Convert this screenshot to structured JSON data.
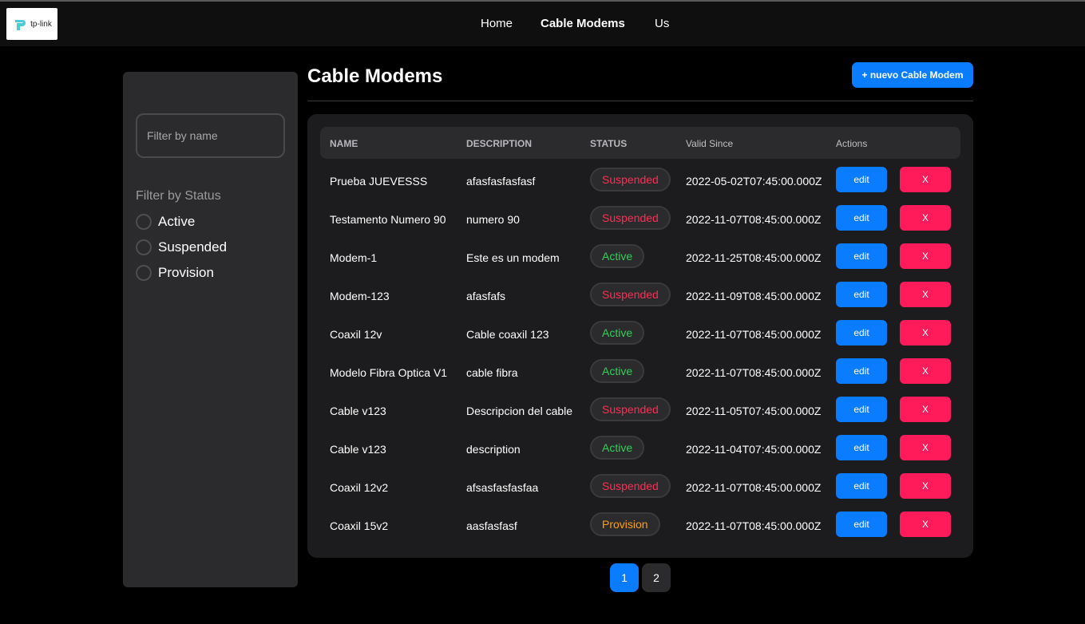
{
  "brand": {
    "logo_text": "tp-link"
  },
  "nav": {
    "items": [
      {
        "label": "Home",
        "active": false
      },
      {
        "label": "Cable Modems",
        "active": true
      },
      {
        "label": "Us",
        "active": false
      }
    ]
  },
  "sidebar": {
    "search_placeholder": "Filter by name",
    "search_value": "",
    "filter_title": "Filter by Status",
    "status_options": [
      {
        "label": "Active",
        "checked": false
      },
      {
        "label": "Suspended",
        "checked": false
      },
      {
        "label": "Provision",
        "checked": false
      }
    ]
  },
  "main": {
    "title": "Cable Modems",
    "new_button_label": "+ nuevo Cable Modem"
  },
  "table": {
    "headers": [
      "NAME",
      "DESCRIPTION",
      "STATUS",
      "Valid Since",
      "Actions"
    ],
    "edit_label": "edit",
    "delete_label": "X",
    "rows": [
      {
        "name": "Prueba JUEVESSS",
        "description": "afasfasfasfasf",
        "status": "Suspended",
        "valid_since": "2022-05-02T07:45:00.000Z"
      },
      {
        "name": "Testamento Numero 90",
        "description": "numero 90",
        "status": "Suspended",
        "valid_since": "2022-11-07T08:45:00.000Z"
      },
      {
        "name": "Modem-1",
        "description": "Este es un modem",
        "status": "Active",
        "valid_since": "2022-11-25T08:45:00.000Z"
      },
      {
        "name": "Modem-123",
        "description": "afasfafs",
        "status": "Suspended",
        "valid_since": "2022-11-09T08:45:00.000Z"
      },
      {
        "name": "Coaxil 12v",
        "description": "Cable coaxil 123",
        "status": "Active",
        "valid_since": "2022-11-07T08:45:00.000Z"
      },
      {
        "name": "Modelo Fibra Optica V1",
        "description": "cable fibra",
        "status": "Active",
        "valid_since": "2022-11-07T08:45:00.000Z"
      },
      {
        "name": "Cable v123",
        "description": "Descripcion del cable",
        "status": "Suspended",
        "valid_since": "2022-11-05T07:45:00.000Z"
      },
      {
        "name": "Cable v123",
        "description": "description",
        "status": "Active",
        "valid_since": "2022-11-04T07:45:00.000Z"
      },
      {
        "name": "Coaxil 12v2",
        "description": "afsasfasfasfaa",
        "status": "Suspended",
        "valid_since": "2022-11-07T08:45:00.000Z"
      },
      {
        "name": "Coaxil 15v2",
        "description": "aasfasfasf",
        "status": "Provision",
        "valid_since": "2022-11-07T08:45:00.000Z"
      }
    ]
  },
  "pagination": {
    "pages": [
      "1",
      "2"
    ],
    "current": "1"
  },
  "colors": {
    "primary": "#0a7cff",
    "danger": "#ff1a5a",
    "status_suspended": "#ff2d55",
    "status_active": "#30d158",
    "status_provision": "#ff9f0a"
  }
}
